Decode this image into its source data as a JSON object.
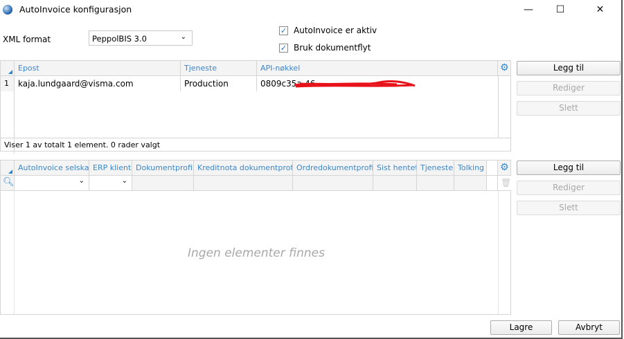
{
  "window": {
    "title": "AutoInvoice konfigurasjon",
    "minimize": "—",
    "maximize": "☐",
    "close": "✕"
  },
  "form": {
    "xml_format_label": "XML format",
    "xml_format_value": "PeppolBIS 3.0",
    "active_label": "AutoInvoice er aktiv",
    "active_checked": true,
    "docflow_label": "Bruk dokumentflyt",
    "docflow_checked": true
  },
  "grid1": {
    "columns": [
      "Epost",
      "Tjeneste",
      "API-nøkkel"
    ],
    "rows": [
      {
        "num": "1",
        "epost": "kaja.lundgaard@visma.com",
        "tjeneste": "Production",
        "api": "0809c35a-46"
      }
    ],
    "status": "Viser 1 av totalt 1 element. 0 rader valgt"
  },
  "grid2": {
    "columns": [
      "AutoInvoice selskap",
      "ERP klient",
      "Dokumentprofil",
      "Kreditnota dokumentprofil",
      "Ordredokumentprofil",
      "Sist hentet",
      "Tjeneste",
      "Tolking"
    ],
    "empty": "Ingen elementer finnes"
  },
  "buttons": {
    "add": "Legg til",
    "edit": "Rediger",
    "delete": "Slett",
    "save": "Lagre",
    "cancel": "Avbryt"
  },
  "colors": {
    "accent": "#3c86c8",
    "redaction": "#e8121a"
  }
}
